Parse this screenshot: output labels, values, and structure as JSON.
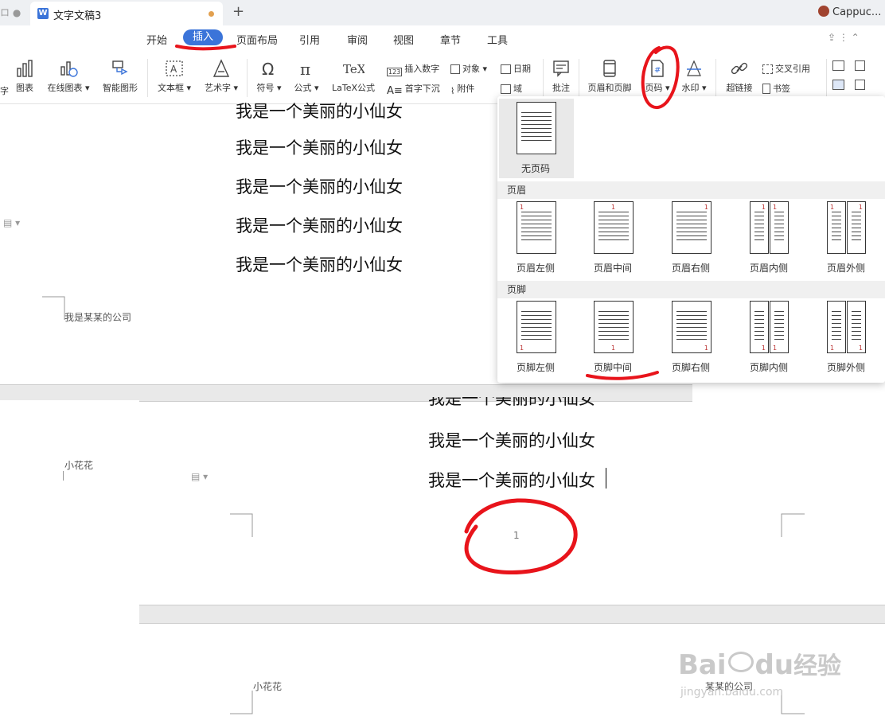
{
  "window": {
    "tab_title": "文字文稿3",
    "new_tab": "+",
    "user_name": "Cappuc..."
  },
  "menu": {
    "items": [
      "开始",
      "插入",
      "页面布局",
      "引用",
      "审阅",
      "视图",
      "章节",
      "工具"
    ],
    "active": "插入"
  },
  "ribbon": {
    "chart": "图表",
    "online_chart": "在线图表",
    "smart_shape": "智能图形",
    "textbox": "文本框",
    "wordart": "艺术字",
    "symbol": "符号",
    "formula": "公式",
    "latex": "LaTeX公式",
    "insert_number": "插入数字",
    "object": "对象",
    "date": "日期",
    "dropcap": "首字下沉",
    "attachment": "附件",
    "field": "域",
    "comment": "批注",
    "header_footer": "页眉和页脚",
    "page_number": "页码",
    "watermark": "水印",
    "hyperlink": "超链接",
    "cross_ref": "交叉引用",
    "bookmark": "书签",
    "cut_left": "字"
  },
  "document": {
    "line_text": "我是某某的公司",
    "body_line": "我是一个美丽的小仙女",
    "footer_left": "小花花",
    "page_number": "1",
    "page2_header_left": "小花花",
    "page2_header_right": "某某的公司"
  },
  "dropdown": {
    "none": "无页码",
    "header_section": "页眉",
    "footer_section": "页脚",
    "header_items": [
      "页眉左侧",
      "页眉中间",
      "页眉右侧",
      "页眉内侧",
      "页眉外侧"
    ],
    "footer_items": [
      "页脚左侧",
      "页脚中间",
      "页脚右侧",
      "页脚内侧",
      "页脚外侧"
    ],
    "sample_number": "1"
  },
  "watermark": {
    "brand": "Bai",
    "brand2": "du",
    "jingyan": "经验",
    "url": "jingyan.baidu.com"
  },
  "colors": {
    "accent": "#3b74d9",
    "annotation": "#e8141b"
  }
}
